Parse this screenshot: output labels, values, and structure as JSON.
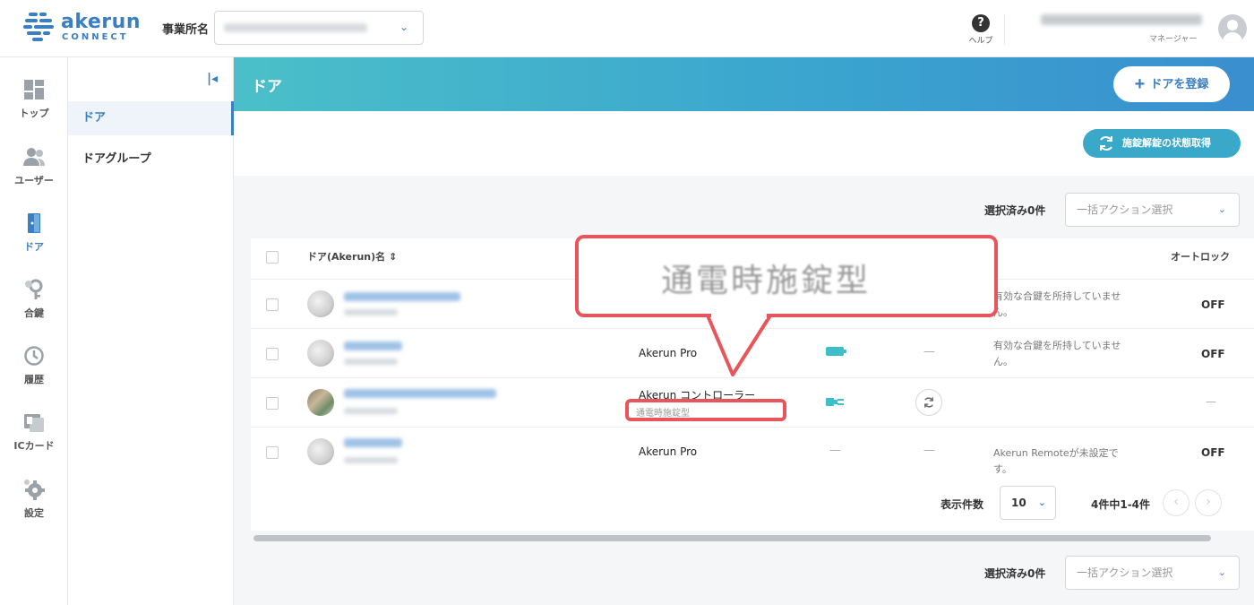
{
  "header": {
    "logo_text": "akerun",
    "logo_sub": "CONNECT",
    "office_label": "事業所名",
    "help_label": "ヘルプ",
    "user_role": "マネージャー"
  },
  "nav": {
    "items": [
      {
        "label": "トップ",
        "icon": "dashboard-icon"
      },
      {
        "label": "ユーザー",
        "icon": "users-icon"
      },
      {
        "label": "ドア",
        "icon": "door-icon"
      },
      {
        "label": "合鍵",
        "icon": "key-icon"
      },
      {
        "label": "履歴",
        "icon": "history-icon"
      },
      {
        "label": "ICカード",
        "icon": "ic-card-icon"
      },
      {
        "label": "設定",
        "icon": "gear-icon"
      }
    ]
  },
  "subnav": {
    "items": [
      {
        "label": "ドア"
      },
      {
        "label": "ドアグループ"
      }
    ]
  },
  "banner": {
    "title": "ドア",
    "register_label": "ドアを登録"
  },
  "toolbar": {
    "status_label": "施錠解錠の状態取得",
    "selected_label": "選択済み0件",
    "bulk_placeholder": "一括アクション選択"
  },
  "table": {
    "columns": {
      "door_name": "ドア(Akerun)名 ⇕",
      "autolock": "オートロック"
    },
    "rows": [
      {
        "model": "",
        "model_sub": "",
        "key_status": "有効な合鍵を所持していません。",
        "autolock": "OFF"
      },
      {
        "model": "Akerun Pro",
        "model_sub": "",
        "power": "—",
        "key_status": "有効な合鍵を所持していません。",
        "autolock": "OFF"
      },
      {
        "model": "Akerun コントローラー",
        "model_sub": "通電時施錠型",
        "key_status": "",
        "autolock": "—"
      },
      {
        "model": "Akerun Pro",
        "model_sub": "",
        "battery": "—",
        "power": "—",
        "key_status": "Akerun Remoteが未設定です。",
        "autolock": "OFF"
      }
    ]
  },
  "pager": {
    "per_page_label": "表示件数",
    "per_page_value": "10",
    "count_label": "4件中1-4件"
  },
  "callout": {
    "text": "通電時施錠型"
  },
  "colors": {
    "accent": "#3a7fc1",
    "teal": "#3dbec8",
    "annotation": "#e8555a"
  }
}
